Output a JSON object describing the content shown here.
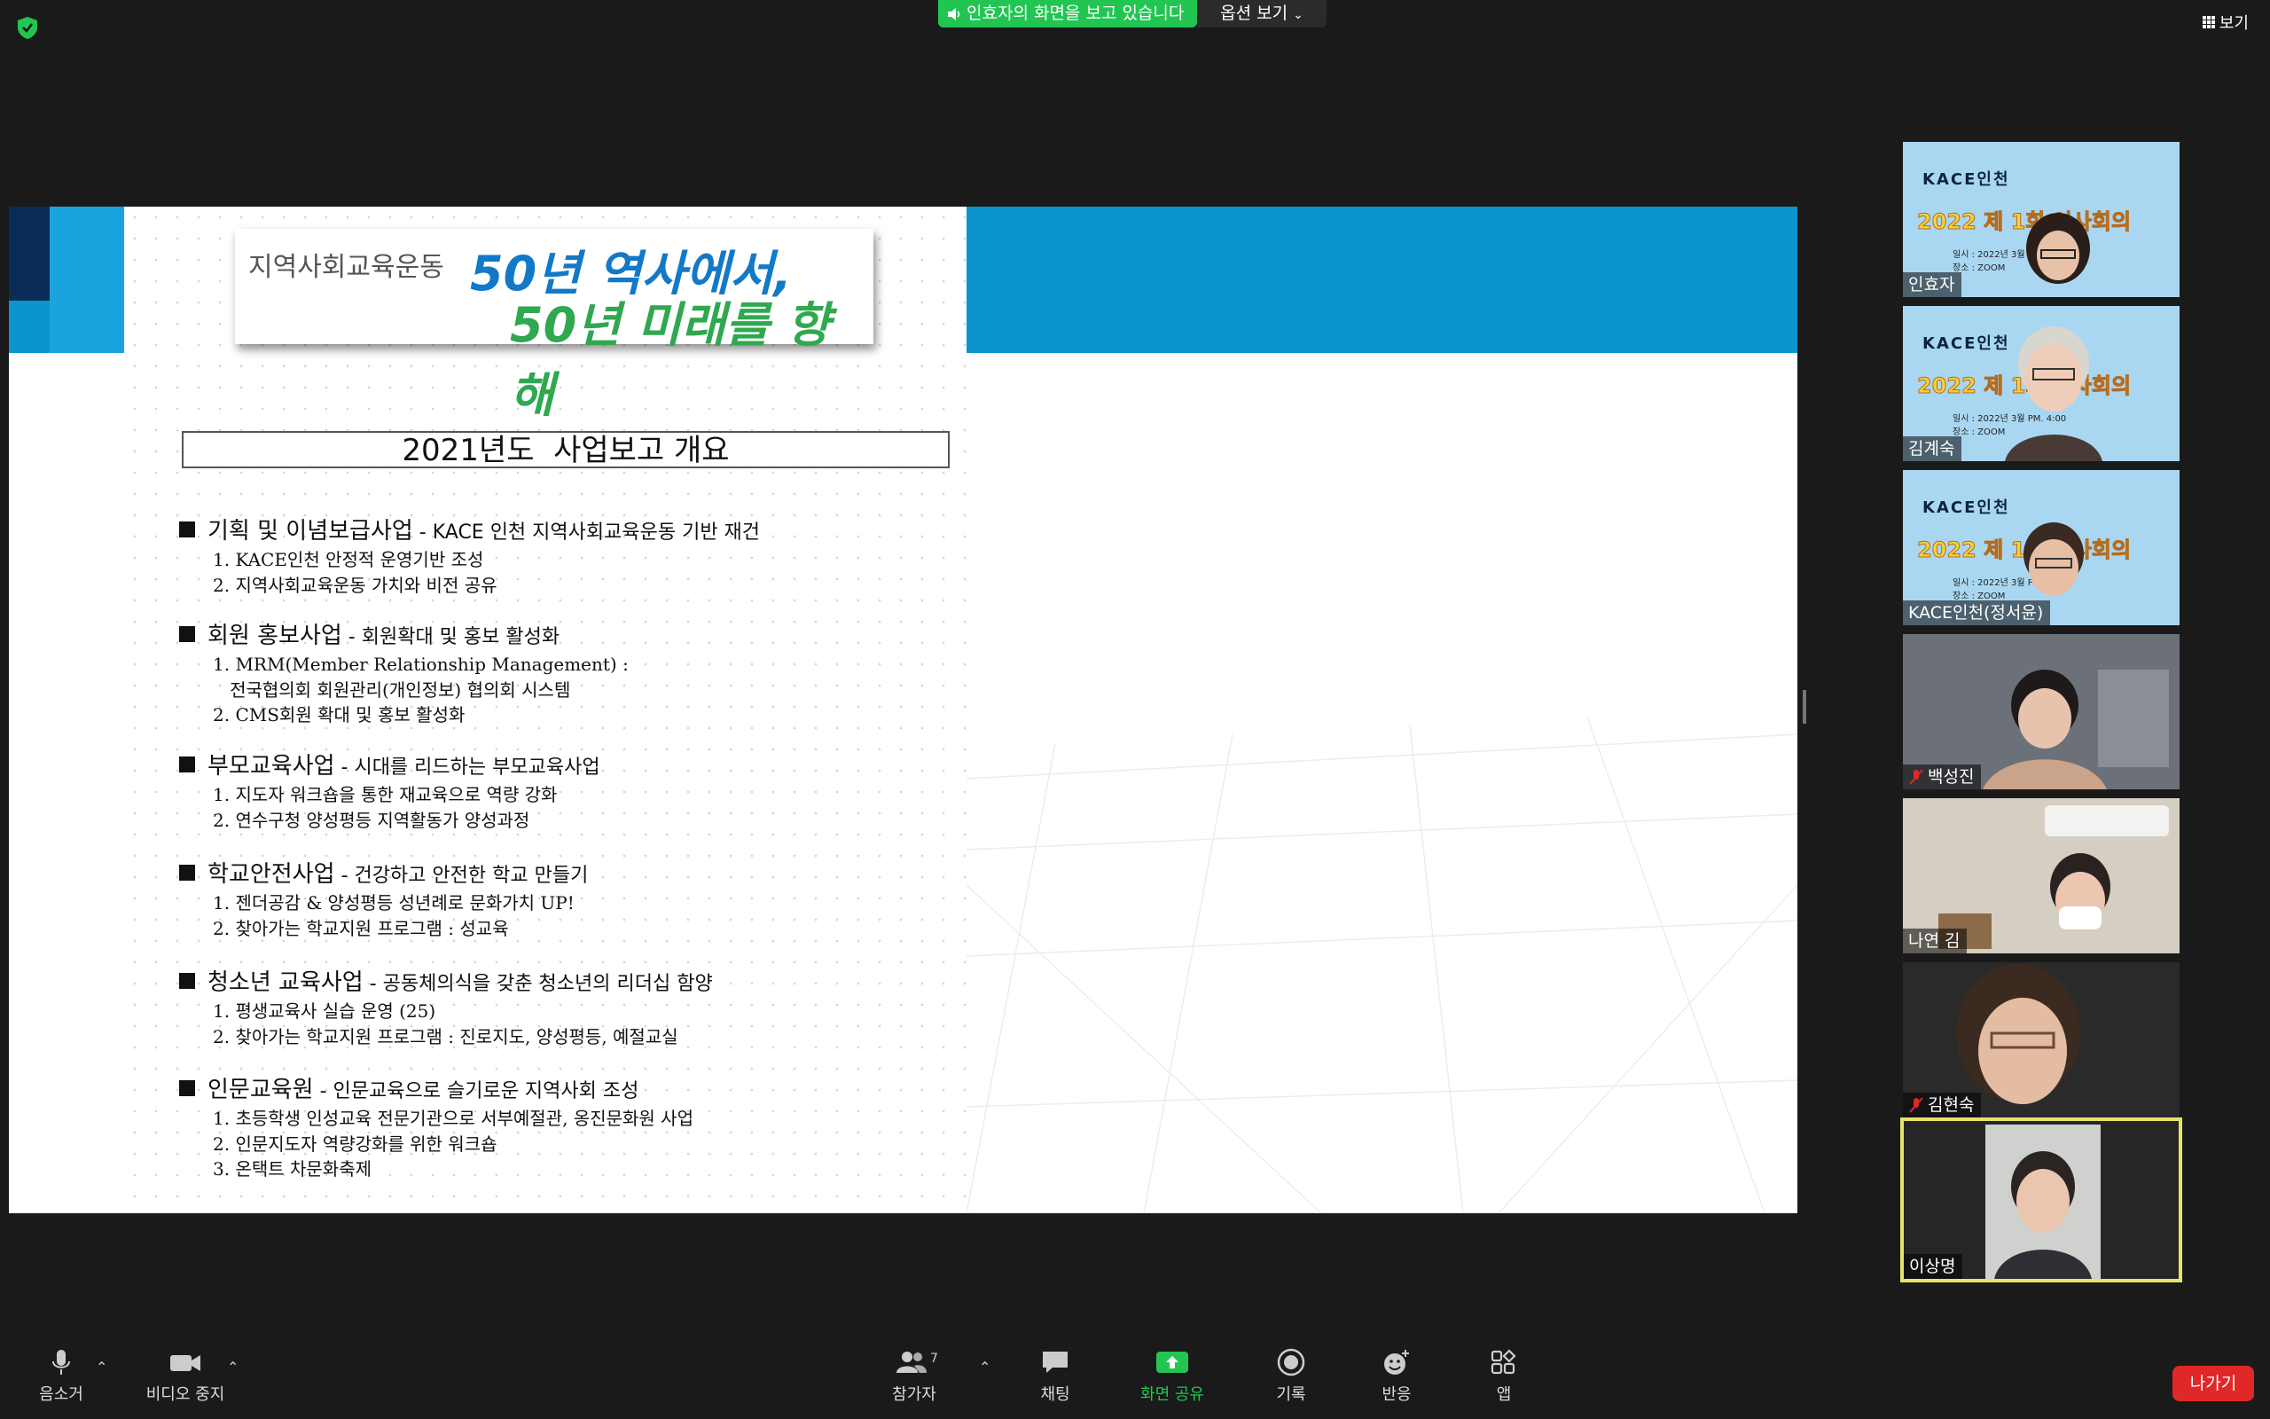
{
  "top_bar": {
    "share_banner": "인효자의 화면을 보고 있습니다",
    "view_options": "옵션 보기",
    "view_button": "보기"
  },
  "slide": {
    "title_card": {
      "small": "지역사회교육운동",
      "line1": "50년 역사에서,",
      "line2": "50년 미래를 향해"
    },
    "heading": "2021년도  사업보고 개요",
    "sections": [
      {
        "title": "기획 및 이념보급사업",
        "subtitle": " - KACE 인천 지역사회교육운동 기반 재건",
        "items": [
          "1. KACE인천 안정적 운영기반 조성",
          "2. 지역사회교육운동 가치와 비전 공유"
        ]
      },
      {
        "title": "회원 홍보사업",
        "subtitle": " - 회원확대 및 홍보 활성화",
        "items": [
          "1. MRM(Member Relationship Management) :",
          "   전국협의회 회원관리(개인정보) 협의회 시스템",
          "2. CMS회원 확대 및 홍보 활성화"
        ]
      },
      {
        "title": "부모교육사업",
        "subtitle": " - 시대를 리드하는 부모교육사업",
        "items": [
          "1. 지도자 워크숍을 통한 재교육으로 역량 강화",
          "2. 연수구청 양성평등 지역활동가 양성과정"
        ]
      },
      {
        "title": "학교안전사업",
        "subtitle": " - 건강하고 안전한 학교 만들기",
        "items": [
          "1. 젠더공감 & 양성평등 성년례로 문화가치 UP!",
          "2. 찾아가는 학교지원 프로그램 : 성교육"
        ]
      },
      {
        "title": "청소년 교육사업",
        "subtitle": " - 공동체의식을 갖춘 청소년의 리더십 함양",
        "items": [
          "1. 평생교육사 실습 운영 (25)",
          "2. 찾아가는 학교지원 프로그램 : 진로지도, 양성평등, 예절교실"
        ]
      },
      {
        "title": "인문교육원",
        "subtitle": " - 인문교육으로 슬기로운 지역사회 조성",
        "items": [
          "1. 초등학생 인성교육 전문기관으로 서부예절관, 옹진문화원 사업",
          "2. 인문지도자 역량강화를 위한 워크숍",
          "3. 온택트 차문화축제"
        ]
      }
    ]
  },
  "participants": [
    {
      "name": "인효자",
      "muted": false,
      "kace": true
    },
    {
      "name": "김계숙",
      "muted": false,
      "kace": true
    },
    {
      "name": "KACE인천(정서윤)",
      "muted": false,
      "kace": true
    },
    {
      "name": "백성진",
      "muted": true,
      "kace": false
    },
    {
      "name": "나연 김",
      "muted": false,
      "kace": false
    },
    {
      "name": "김현숙",
      "muted": true,
      "kace": false
    },
    {
      "name": "이상명",
      "muted": false,
      "kace": false,
      "active": true
    }
  ],
  "kace_bg": {
    "title": "KACE인천",
    "headline": "2022 제 1회 이사회의",
    "line1": "일시 : 2022년 3월 PM. 4:00",
    "line2": "장소 : ZOOM"
  },
  "toolbar": {
    "mute": "음소거",
    "video": "비디오 중지",
    "participants": "참가자",
    "participants_count": "7",
    "chat": "채팅",
    "share": "화면 공유",
    "record": "기록",
    "reactions": "반응",
    "apps": "앱",
    "leave": "나가기"
  },
  "colors": {
    "share_green": "#23c552",
    "leave_red": "#e02828",
    "slide_blue": "#0c95cc",
    "active_speaker": "#e6e36b"
  }
}
